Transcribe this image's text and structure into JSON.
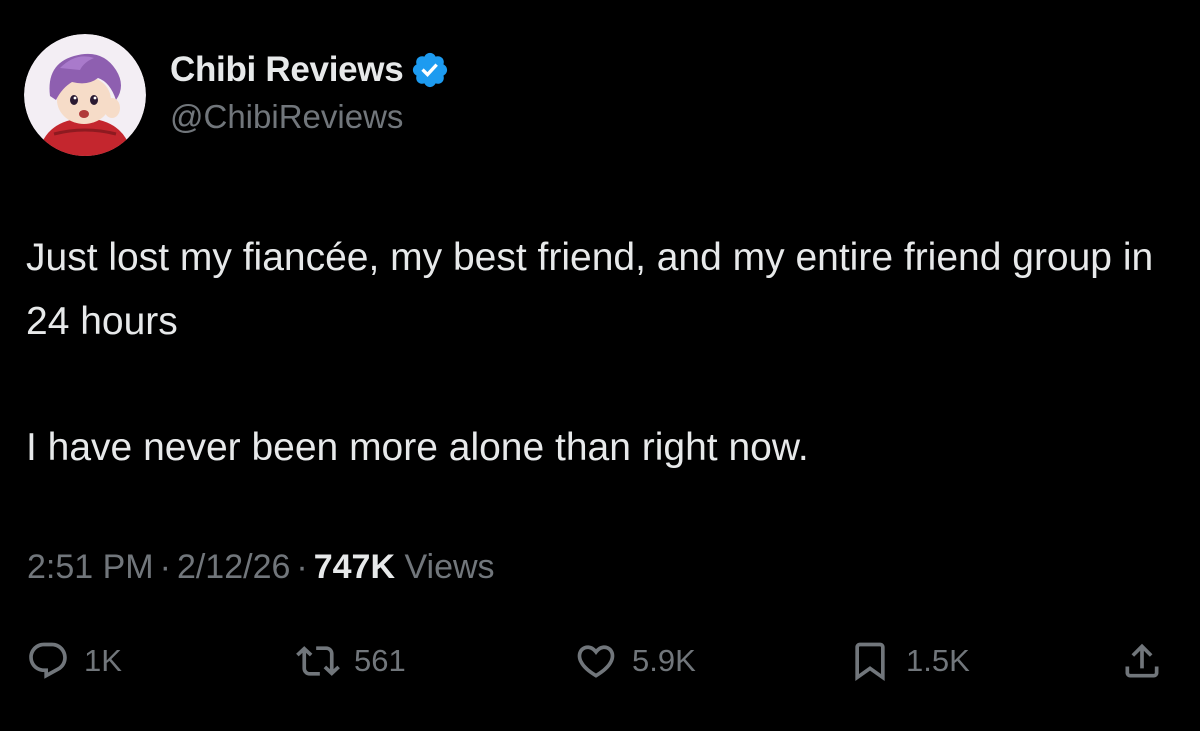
{
  "author": {
    "display_name": "Chibi Reviews",
    "handle": "@ChibiReviews",
    "verified_color": "#1d9bf0",
    "avatar_icon": "chibi-character-avatar"
  },
  "tweet": {
    "paragraphs": [
      "Just lost my fiancée, my best friend, and my entire friend group in 24 hours",
      "I have never been more alone than right now."
    ]
  },
  "meta": {
    "time": "2:51 PM",
    "separator": "·",
    "date": "2/12/26",
    "views_count": "747K",
    "views_label": "Views"
  },
  "actions": {
    "reply": {
      "icon": "reply-bubble-icon",
      "count": "1K"
    },
    "retweet": {
      "icon": "retweet-icon",
      "count": "561"
    },
    "like": {
      "icon": "heart-icon",
      "count": "5.9K"
    },
    "bookmark": {
      "icon": "bookmark-icon",
      "count": "1.5K"
    },
    "share": {
      "icon": "share-icon"
    }
  },
  "colors": {
    "background": "#000000",
    "primary_text": "#e7e9ea",
    "secondary_text": "#71767b",
    "accent": "#1d9bf0"
  }
}
